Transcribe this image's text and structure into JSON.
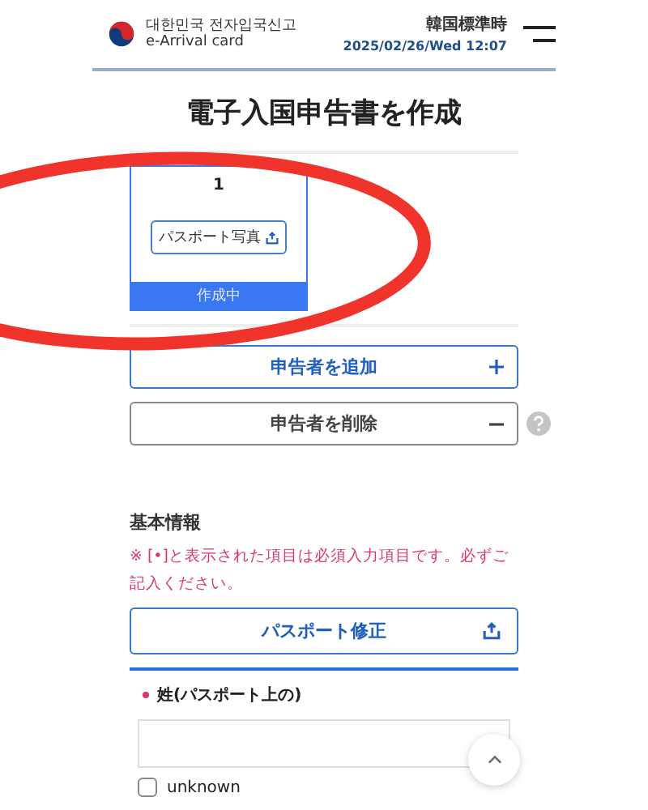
{
  "header": {
    "logo_korean": "대한민국 전자입국신고",
    "logo_english": "e-Arrival card",
    "timezone": "韓国標準時",
    "datetime": "2025/02/26/Wed 12:07"
  },
  "title": "電子入国申告書を作成",
  "applicants": [
    {
      "number": "1",
      "photo_button": "パスポート写真",
      "status": "作成中",
      "selected": true
    }
  ],
  "actions": [
    {
      "kind": "add",
      "label": "申告者を追加"
    },
    {
      "kind": "delete",
      "label": "申告者を削除"
    }
  ],
  "section_title": "基本情報",
  "required_note": "※ [•]と表示された項目は必須入力項目です。必ずご記入ください。",
  "passport_edit_button": "パスポート修正",
  "fields": [
    {
      "label": "姓(パスポート上の)",
      "required": true,
      "unknown": {
        "label": "unknown",
        "checked": false
      }
    }
  ]
}
